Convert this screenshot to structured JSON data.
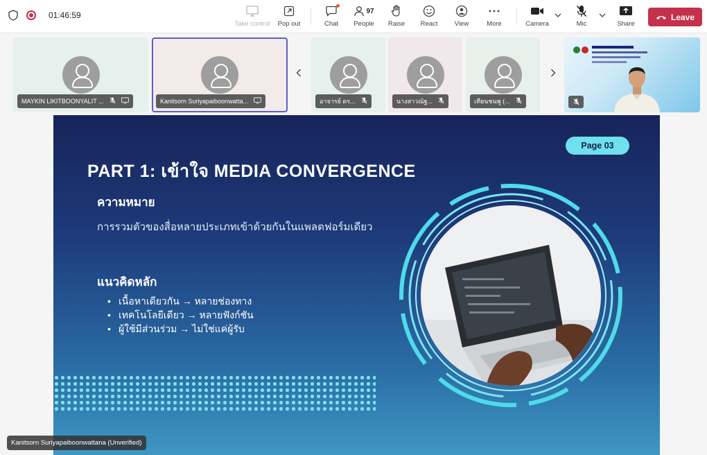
{
  "meeting": {
    "timer": "01:46:59"
  },
  "toolbar": {
    "take_control": "Take control",
    "pop_out": "Pop out",
    "chat": "Chat",
    "people": "People",
    "people_count": "97",
    "raise": "Raise",
    "react": "React",
    "view": "View",
    "more": "More",
    "camera": "Camera",
    "mic": "Mic",
    "share": "Share",
    "leave": "Leave"
  },
  "participants": [
    {
      "name": "MAYKIN LIKITBOONYALIT ...",
      "bg": "#e6f1ee"
    },
    {
      "name": "Kanitsorn Suriyapaiboonwatta...",
      "bg": "#f3eaea"
    },
    {
      "name": "อาจารย์ ดร...",
      "bg": "#e6f1ee"
    },
    {
      "name": "นางสาวณัฐ...",
      "bg": "#f0e8ea"
    },
    {
      "name": "เทียนชนพู (...",
      "bg": "#e8f0ec"
    }
  ],
  "slide": {
    "page": "Page 03",
    "title": "PART 1: เข้าใจ MEDIA CONVERGENCE",
    "heading1": "ความหมาย",
    "text1": "การรวมตัวของสื่อหลายประเภทเข้าด้วยกันในแพลตฟอร์มเดียว",
    "heading2": "แนวคิดหลัก",
    "bullets": [
      "เนื้อหาเดียวกัน → หลายช่องทาง",
      "เทคโนโลยีเดียว → หลายฟังก์ชัน",
      "ผู้ใช้มีส่วนร่วม → ไม่ใช่แค่ผู้รับ"
    ]
  },
  "presenter_caption": "Kanitsorn Suriyapaiboonwattana (Unverified)",
  "colors": {
    "leave": "#c4314b",
    "selected_border": "#5b5fc7",
    "accent_cyan": "#6fe0ee",
    "recording": "#c4314b"
  }
}
